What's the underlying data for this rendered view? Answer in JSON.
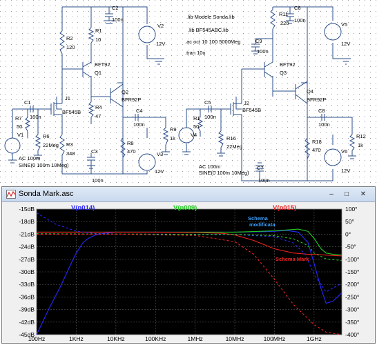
{
  "window": {
    "title": "Sonda Mark.asc",
    "buttons": [
      "–",
      "□",
      "✕"
    ]
  },
  "schematic": {
    "directives": [
      ".lib Modele Sonda.lib",
      ".lib BF545ABC.lib",
      ".ac oct 10 100 5000Meg",
      ".tran 10u"
    ],
    "left": {
      "c2": "C2",
      "c2v": "100n",
      "r1": "R1",
      "r1v": "10",
      "r2": "R2",
      "r2v": "120",
      "q1": "Q1",
      "q1m": "BFT92",
      "v2": "V2",
      "v2v": "12V",
      "j1": "J1",
      "j1m": "BF545B",
      "r4": "R4",
      "r4v": "47",
      "q2": "Q2",
      "q2m": "BFR92P",
      "c1": "C1",
      "c1v": "100n",
      "r7": "R7",
      "r7v": "50",
      "r6": "R6",
      "r6v": "22Meg",
      "r3": "R3",
      "r3v": "348",
      "c4": "C4",
      "c4v": "100n",
      "r9": "R9",
      "r9v": "1k",
      "r8": "R8",
      "r8v": "470",
      "v1": "V1",
      "v3": "V3",
      "v3v": "12V",
      "c3": "C3",
      "c3v": "100n",
      "ac": "AC 100m",
      "sine": "SINE(0 100m 10Meg)"
    },
    "right": {
      "r11": "R11",
      "r11v": "220",
      "c6": "C6",
      "c6v": "100n",
      "c9": "C9",
      "c9v": "100n",
      "q3": "Q3",
      "q3m": "BFT92",
      "v5": "V5",
      "v5v": "12V",
      "q4": "Q4",
      "q4m": "BFR92P",
      "c5": "C5",
      "c5v": "100n",
      "j2": "J2",
      "j2m": "BF545B",
      "r1x": "R1",
      "r1xv": "50",
      "r16": "R16",
      "r16v": "22Meg",
      "v4": "V4",
      "c8": "C8",
      "c8v": "100n",
      "r12": "R12",
      "r12v": "1k",
      "r18": "R18",
      "r18v": "470",
      "v6": "V6",
      "v6v": "12V",
      "c7": "C7",
      "c7v": "100n",
      "ac": "AC 100m",
      "sine": "SINE(0 100m 10Meg)"
    }
  },
  "chart_data": {
    "type": "line",
    "x_scale": "log",
    "x_ticks": [
      "100Hz",
      "1KHz",
      "10KHz",
      "100KHz",
      "1MHz",
      "10MHz",
      "100MHz",
      "1GHz"
    ],
    "x_range_hz": [
      100,
      5000000000
    ],
    "y_left_ticks": [
      "-15dB",
      "-18dB",
      "-21dB",
      "-24dB",
      "-27dB",
      "-30dB",
      "-33dB",
      "-36dB",
      "-39dB",
      "-42dB",
      "-45dB"
    ],
    "y_left_range_db": [
      -45,
      -15
    ],
    "y_right_ticks": [
      "100°",
      "50°",
      "0°",
      "-50°",
      "-100°",
      "-150°",
      "-200°",
      "-250°",
      "-300°",
      "-350°",
      "-400°"
    ],
    "y_right_range_deg": [
      -400,
      100
    ],
    "grid": true,
    "legend": [
      {
        "name": "V(n014)",
        "color": "#2828ff"
      },
      {
        "name": "V(n009)",
        "color": "#22cc22"
      },
      {
        "name": "V(n015)",
        "color": "#ee2222"
      }
    ],
    "annotations": [
      {
        "text": "Schema",
        "color": "#3aa0ff"
      },
      {
        "text": "modificata",
        "color": "#3aa0ff"
      },
      {
        "text": "Schema Mark",
        "color": "#ee2222"
      }
    ],
    "series": [
      {
        "name": "V(n014)",
        "color": "#2828ff",
        "style": "solid",
        "freq_hz": [
          100,
          200,
          400,
          700,
          1000,
          1500,
          2000,
          3000,
          5000,
          10000,
          100000,
          1000000,
          10000000,
          50000000,
          100000000,
          200000000,
          400000000,
          700000000,
          1000000000,
          1500000000,
          2000000000,
          3000000000,
          5000000000
        ],
        "db": [
          -45,
          -39,
          -33.5,
          -28.5,
          -25.5,
          -23,
          -22,
          -21.2,
          -20.8,
          -20.5,
          -20.5,
          -20.5,
          -20.5,
          -20.4,
          -20.3,
          -20.1,
          -20.5,
          -23,
          -28,
          -34,
          -37.5,
          -37,
          -35
        ]
      },
      {
        "name": "V(n009)",
        "color": "#22cc22",
        "style": "solid",
        "freq_hz": [
          100,
          1000,
          10000,
          100000,
          1000000,
          10000000,
          100000000,
          200000000,
          400000000,
          700000000,
          1000000000,
          1500000000,
          2000000000,
          3000000000,
          5000000000
        ],
        "db": [
          -20.5,
          -20.5,
          -20.5,
          -20.5,
          -20.5,
          -20.5,
          -20.2,
          -20,
          -19.8,
          -20.3,
          -22,
          -24.5,
          -25.5,
          -25.8,
          -26
        ]
      },
      {
        "name": "V(n015)",
        "color": "#ee2222",
        "style": "solid",
        "freq_hz": [
          100,
          1000,
          10000,
          100000,
          1000000,
          5000000,
          10000000,
          30000000,
          100000000,
          300000000,
          700000000,
          1000000000,
          2000000000,
          5000000000
        ],
        "db": [
          -20.5,
          -20.5,
          -20.5,
          -20.5,
          -20.6,
          -20.8,
          -21.2,
          -22.5,
          -24.5,
          -25.5,
          -25.8,
          -25.8,
          -26,
          -26.2
        ]
      },
      {
        "name": "V(n014) phase",
        "color": "#2828ff",
        "style": "dashed",
        "axis": "right",
        "freq_hz": [
          100,
          300,
          1000,
          3000,
          10000,
          100000,
          10000000,
          100000000,
          300000000,
          600000000,
          1000000000,
          2000000000,
          5000000000
        ],
        "deg": [
          85,
          40,
          12,
          3,
          0,
          0,
          -2,
          -10,
          -35,
          -80,
          -160,
          -230,
          -195
        ]
      },
      {
        "name": "V(n009) phase",
        "color": "#22cc22",
        "style": "dashed",
        "axis": "right",
        "freq_hz": [
          100,
          1000,
          100000,
          10000000,
          100000000,
          300000000,
          700000000,
          1000000000,
          2000000000,
          5000000000
        ],
        "deg": [
          2,
          1,
          0,
          -1,
          -6,
          -18,
          -45,
          -75,
          -98,
          -105
        ]
      },
      {
        "name": "V(n015) phase",
        "color": "#ee2222",
        "style": "dashed",
        "axis": "right",
        "freq_hz": [
          100,
          10000,
          1000000,
          10000000,
          30000000,
          100000000,
          300000000,
          1000000000,
          2000000000,
          5000000000
        ],
        "deg": [
          0,
          0,
          -5,
          -30,
          -80,
          -180,
          -280,
          -360,
          -390,
          -400
        ]
      }
    ]
  }
}
